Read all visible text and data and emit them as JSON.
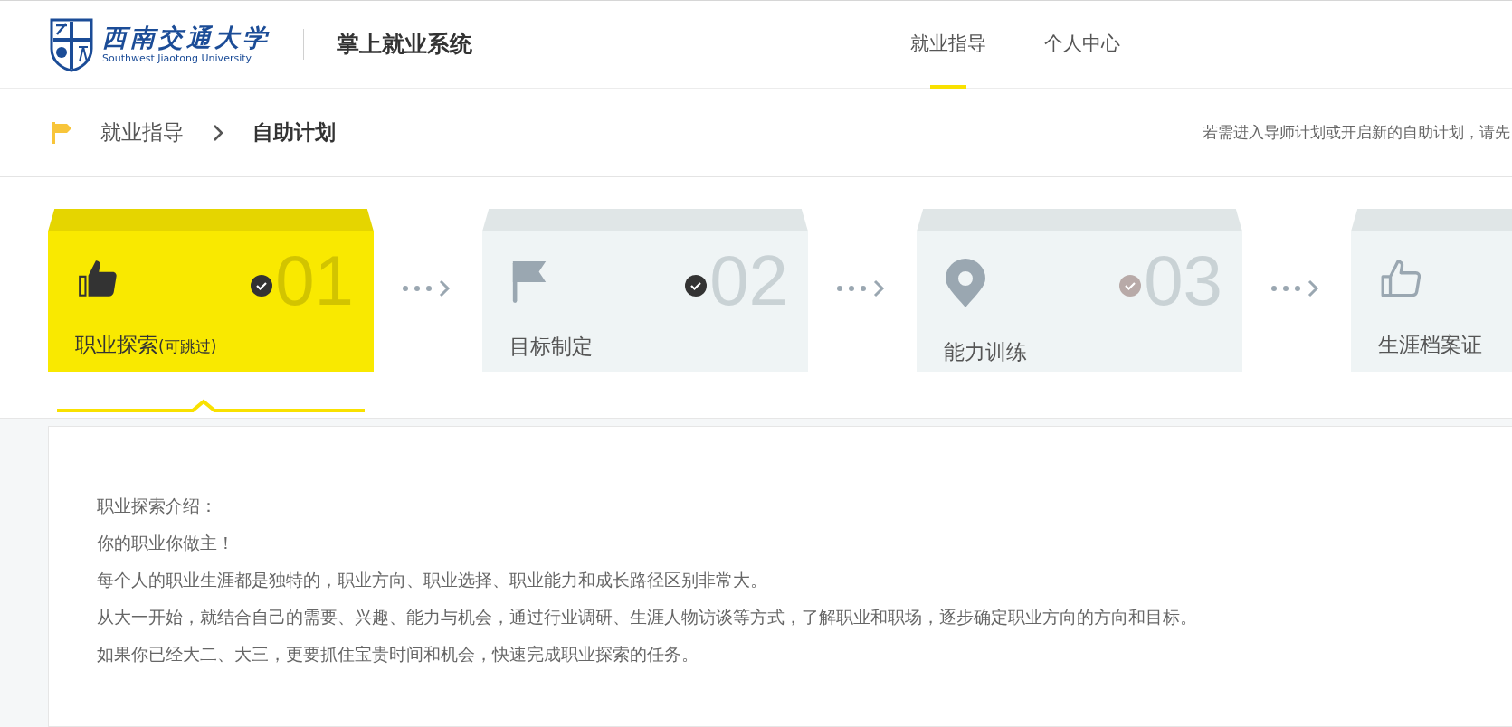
{
  "header": {
    "logo_cn": "西南交通大学",
    "logo_en": "Southwest Jiaotong University",
    "system_title": "掌上就业系统",
    "nav": [
      {
        "label": "就业指导",
        "selected": true
      },
      {
        "label": "个人中心",
        "selected": false
      }
    ]
  },
  "breadcrumb": {
    "items": [
      "就业指导",
      "自助计划"
    ],
    "notice": "若需进入导师计划或开启新的自助计划，请先"
  },
  "steps": [
    {
      "title": "职业探索",
      "subtitle": "(可跳过)",
      "number": "01",
      "selected": true,
      "completed": true
    },
    {
      "title": "目标制定",
      "number": "02",
      "selected": false,
      "completed": true
    },
    {
      "title": "能力训练",
      "number": "03",
      "selected": false,
      "completed": false
    },
    {
      "title": "生涯档案证",
      "selected": false
    }
  ],
  "intro": {
    "lines": [
      "职业探索介绍：",
      "你的职业你做主！",
      "每个人的职业生涯都是独特的，职业方向、职业选择、职业能力和成长路径区别非常大。",
      "从大一开始，就结合自己的需要、兴趣、能力与机会，通过行业调研、生涯人物访谈等方式，了解职业和职场，逐步确定职业方向的方向和目标。",
      "如果你已经大二、大三，更要抓住宝贵时间和机会，快速完成职业探索的任务。"
    ]
  }
}
